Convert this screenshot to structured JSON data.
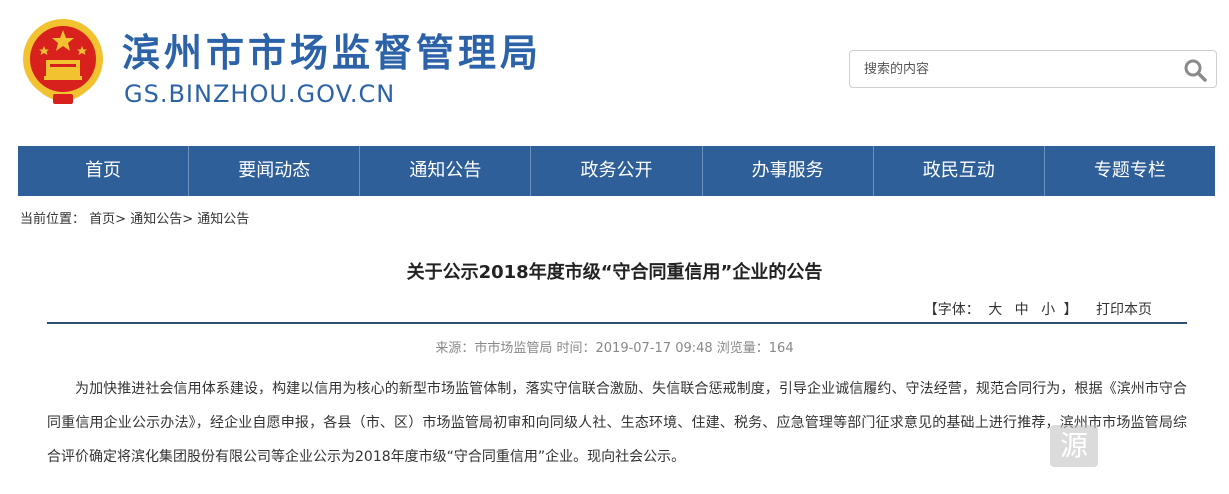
{
  "header": {
    "site_name": "滨州市市场监督管理局",
    "site_domain": "GS.BINZHOU.GOV.CN",
    "emblem_icon": "national-emblem-icon"
  },
  "search": {
    "placeholder": "搜索的内容",
    "icon": "search-icon"
  },
  "nav": {
    "items": [
      {
        "label": "首页"
      },
      {
        "label": "要闻动态"
      },
      {
        "label": "通知公告"
      },
      {
        "label": "政务公开"
      },
      {
        "label": "办事服务"
      },
      {
        "label": "政民互动"
      },
      {
        "label": "专题专栏"
      }
    ]
  },
  "breadcrumb": {
    "prefix": "当前位置：",
    "items": [
      "首页",
      "通知公告",
      "通知公告"
    ],
    "separator": "> "
  },
  "article": {
    "title": "关于公示2018年度市级“守合同重信用”企业的公告",
    "font_tool": {
      "open": "【字体：",
      "large": "大",
      "medium": "中",
      "small": "小",
      "close": "】"
    },
    "print_label": "打印本页",
    "meta": "来源：市市场监管局  时间：2019-07-17 09:48  浏览量：164",
    "body": "为加快推进社会信用体系建设，构建以信用为核心的新型市场监管体制，落实守信联合激励、失信联合惩戒制度，引导企业诚信履约、守法经营，规范合同行为，根据《滨州市守合同重信用企业公示办法》，经企业自愿申报，各县（市、区）市场监管局初审和向同级人社、生态环境、住建、税务、应急管理等部门征求意见的基础上进行推荐，滨州市市场监管局综合评价确定将滨化集团股份有限公司等企业公示为2018年度市级“守合同重信用”企业。现向社会公示。"
  },
  "colors": {
    "brand_blue": "#2c62a8",
    "nav_blue": "#2f5f98",
    "emblem_red": "#d8201d",
    "emblem_gold": "#f2c230"
  }
}
